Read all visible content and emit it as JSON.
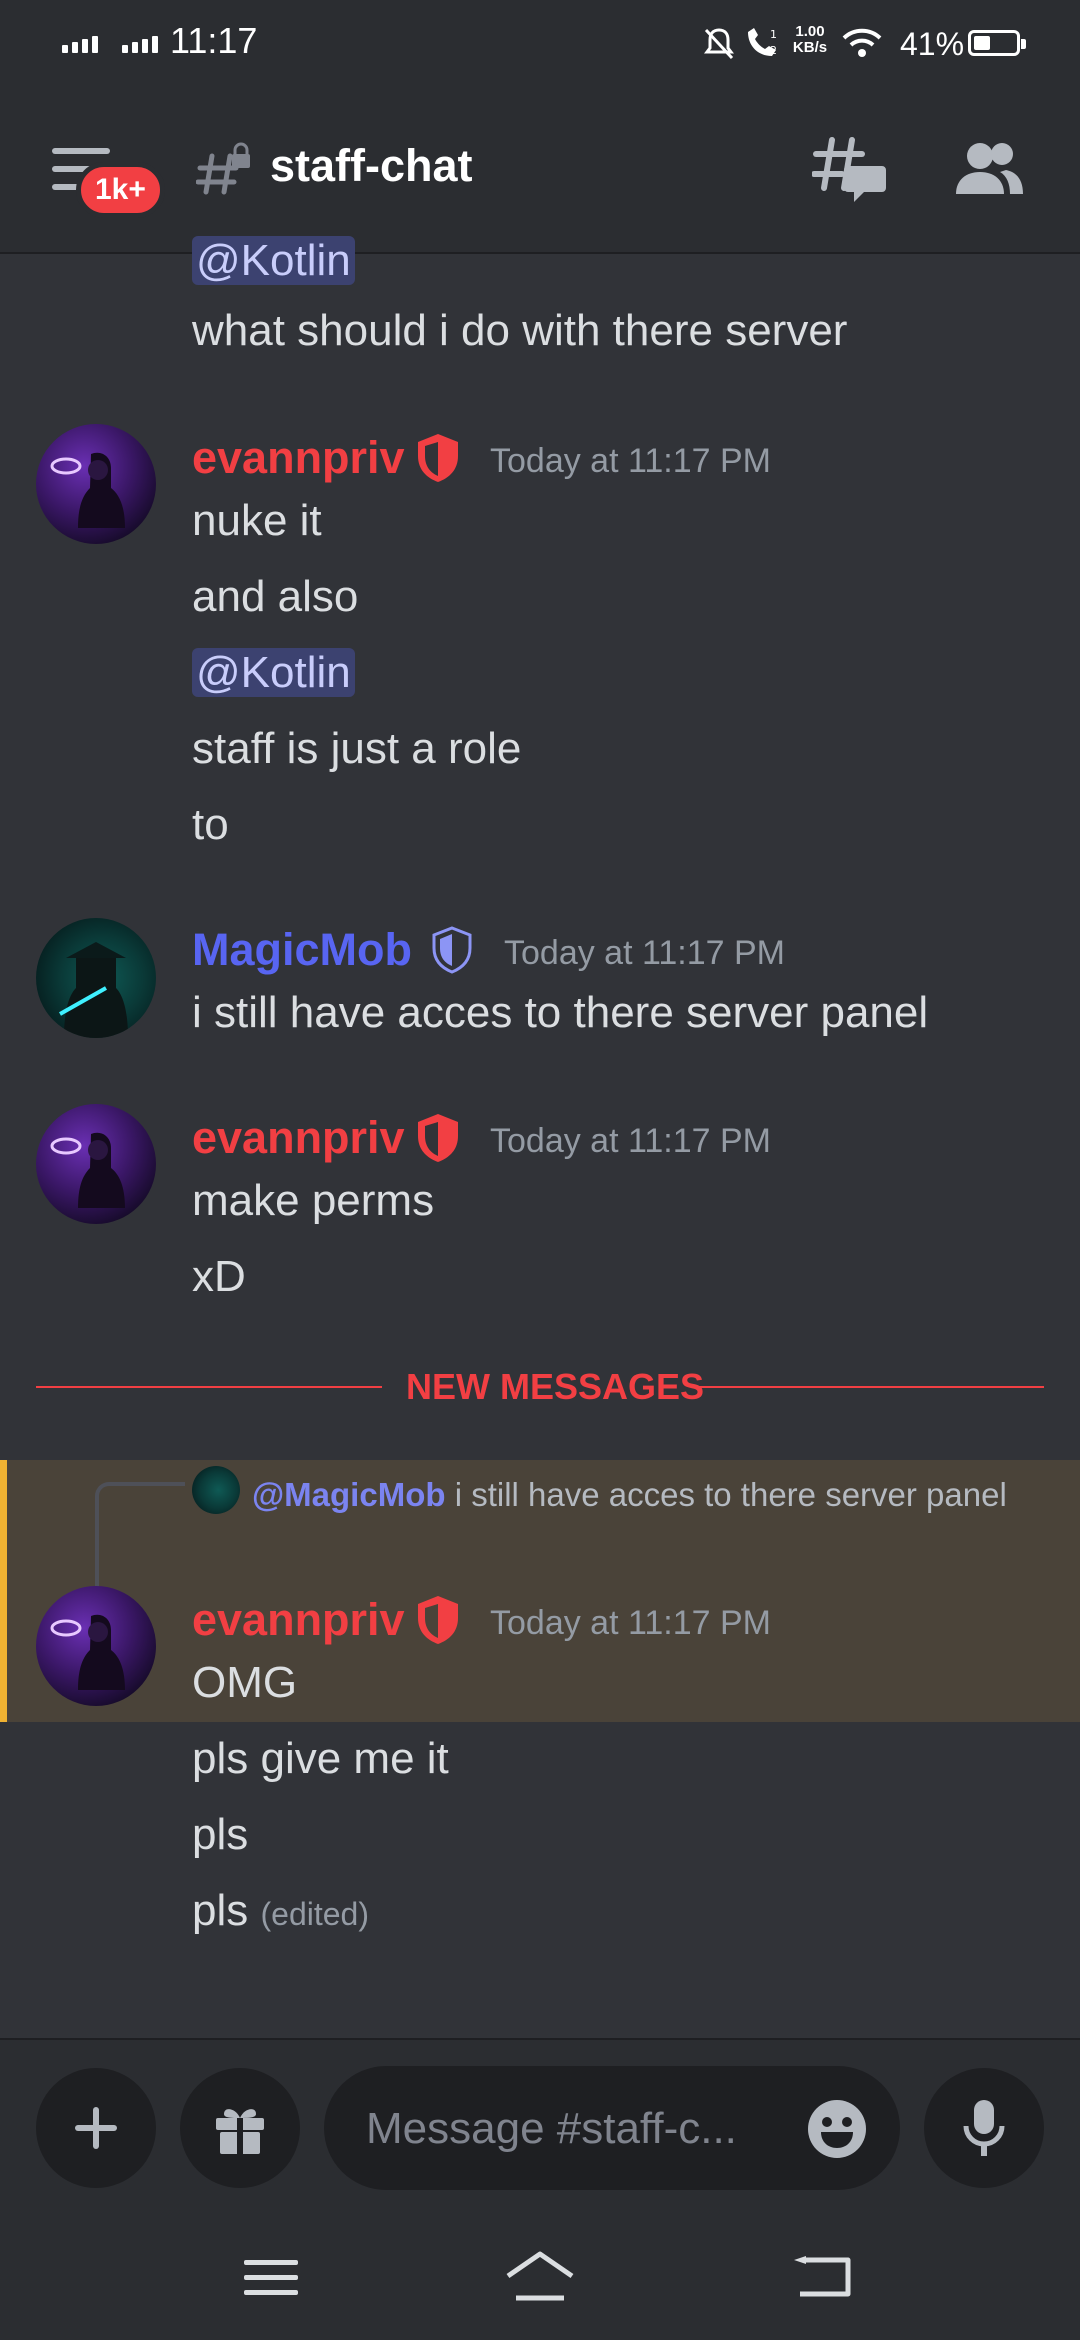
{
  "status_bar": {
    "time": "11:17",
    "net_speed_value": "1.00",
    "net_speed_unit": "KB/s",
    "battery": "41%",
    "battery_level": 0.41
  },
  "header": {
    "channel_name": "staff-chat",
    "notification_badge": "1k+"
  },
  "messages": {
    "top_mention": "@Kotlin",
    "top_text": "what should i do with there server",
    "group1": {
      "user": "evannpriv",
      "time": "Today at 11:17 PM",
      "lines": [
        "nuke it",
        "and also",
        "@Kotlin",
        "staff is just a role",
        "to"
      ]
    },
    "group2": {
      "user": "MagicMob",
      "time": "Today at 11:17 PM",
      "lines": [
        "i still have acces to there server panel"
      ]
    },
    "group3": {
      "user": "evannpriv",
      "time": "Today at 11:17 PM",
      "lines": [
        "make perms",
        "xD"
      ]
    },
    "new_messages_label": "NEW MESSAGES",
    "group4": {
      "reply_mention": "@MagicMob",
      "reply_text": "i still have acces to there server panel",
      "user": "evannpriv",
      "time": "Today at 11:17 PM",
      "lines": [
        "OMG",
        "pls give me it",
        "pls",
        "pls"
      ],
      "edited_label": "(edited)"
    }
  },
  "composer": {
    "placeholder": "Message #staff-c..."
  },
  "colors": {
    "evannpriv": "#f23f43",
    "magicmob": "#5865f2",
    "background": "#313338",
    "highlight": "#4a4339",
    "highlight_bar": "#f0b232"
  }
}
